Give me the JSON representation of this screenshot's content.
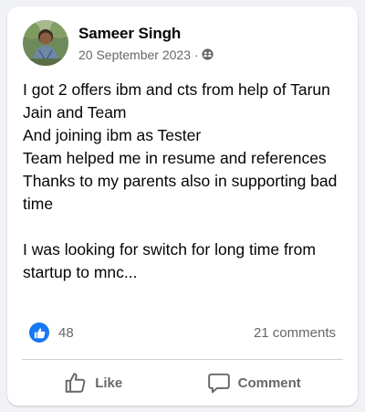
{
  "post": {
    "author": "Sameer Singh",
    "date": "20 September 2023",
    "separator": "·",
    "audience_icon": "friends-icon",
    "text": "I got 2 offers ibm and cts from help of Tarun Jain and Team\nAnd joining ibm as Tester\nTeam helped me in resume and references\nThanks to my parents also in supporting bad time\n\nI was looking for switch for long time from startup to mnc..."
  },
  "stats": {
    "like_count": "48",
    "comments": "21 comments"
  },
  "actions": {
    "like_label": "Like",
    "comment_label": "Comment"
  },
  "colors": {
    "accent": "#1877f2",
    "secondary_text": "#65676b",
    "primary_text": "#050505"
  }
}
